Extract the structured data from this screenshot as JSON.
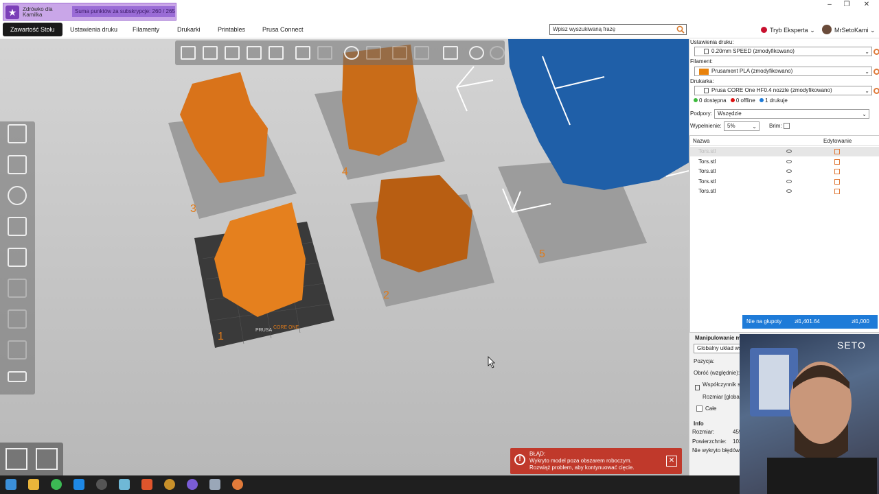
{
  "stream_badge": {
    "name": "Zdrówko dla Kamilka",
    "subscription": "Suma punktów za subskrypcje: 260 / 265"
  },
  "window_controls": {
    "minimize": "–",
    "maximize": "❐",
    "close": "✕"
  },
  "menu": {
    "tabs": [
      "Zawartość Stołu",
      "Ustawienia druku",
      "Filamenty",
      "Drukarki",
      "Printables",
      "Prusa Connect"
    ],
    "active_tab": "Zawartość Stołu",
    "search_placeholder": "Wpisz wyszukiwaną frazę",
    "expert_mode": "Tryb Eksperta",
    "user": "MrSetoKami"
  },
  "viewport": {
    "bed_numbers": [
      "1",
      "2",
      "3",
      "4",
      "5"
    ],
    "bed_brand": "PRUSA",
    "bed_model": "CORE ONE",
    "model_color": "#e07b1a",
    "scan_color": "#1f5fa8"
  },
  "toast": {
    "title": "BŁĄD:",
    "line1": "Wykryto model poza obszarem roboczym.",
    "line2": "Rozwiąż problem, aby kontynuować cięcie."
  },
  "panel": {
    "print_settings_label": "Ustawienia druku:",
    "print_settings_value": "0.20mm SPEED (zmodyfikowano)",
    "filament_label": "Filament:",
    "filament_value": "Prusament PLA (zmodyfikowano)",
    "printer_label": "Drukarka:",
    "printer_value": "Prusa CORE One HF0.4 nozzle (zmodyfikowano)",
    "status": {
      "available": "0 dostępna",
      "offline": "0 offline",
      "printing": "1 drukuje"
    },
    "supports_label": "Podpory:",
    "supports_value": "Wszędzie",
    "infill_label": "Wypełnienie:",
    "infill_value": "5%",
    "brim_label": "Brim:",
    "list_headers": {
      "name": "Nazwa",
      "edit": "Edytowanie"
    },
    "objects": [
      "Tors.stl",
      "Tors.stl",
      "Tors.stl",
      "Tors.stl",
      "Tors.stl"
    ],
    "price_bar": {
      "label": "Nie na głupoty",
      "amount": "zł1,401.64",
      "goal": "zł1,000"
    },
    "manipulation": {
      "title": "Manipulowanie m",
      "coordinate_system": "Globalny układ wsp",
      "position": "Pozycja:",
      "rotate": "Obróć (względnie):",
      "scale": "Współczynnik s",
      "size": "Rozmiar [global",
      "whole": "Całe"
    },
    "info": {
      "title": "Info",
      "size_label": "Rozmiar:",
      "size_value": "459",
      "surface_label": "Powierzchnie:",
      "surface_value": "103",
      "errors": "Nie wykryto błędów"
    }
  },
  "webcam": {
    "overlay_text": "SETO"
  }
}
